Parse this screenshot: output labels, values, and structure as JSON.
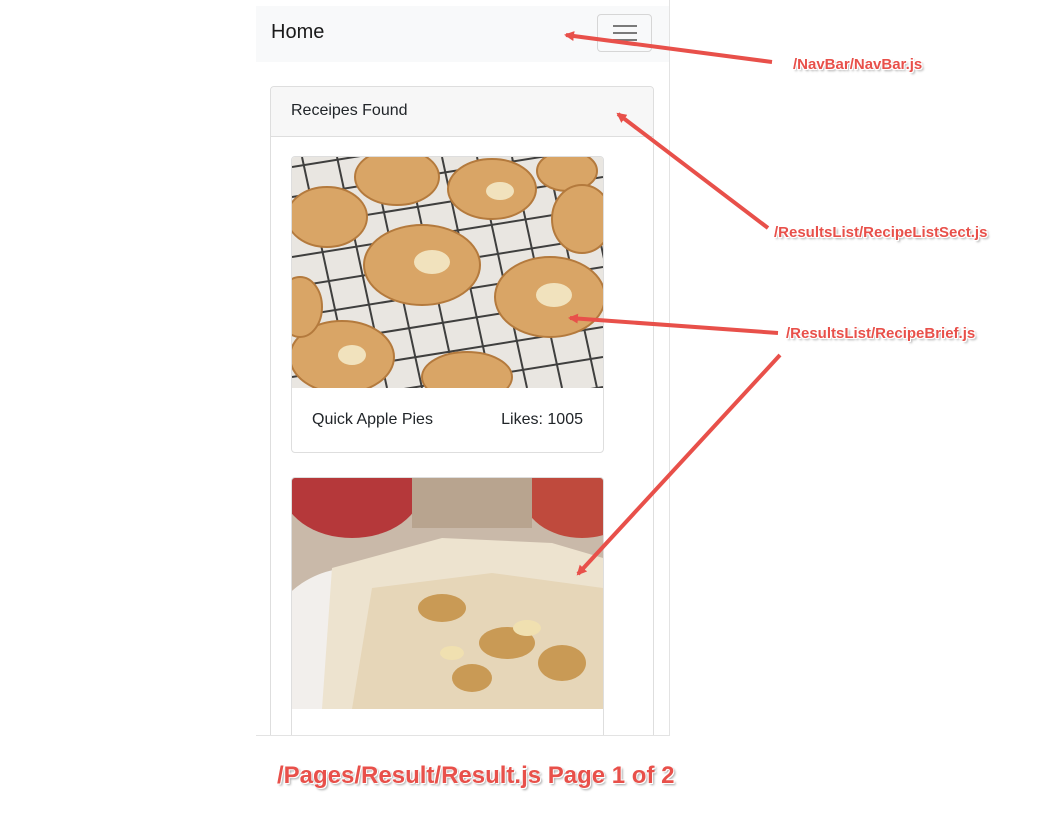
{
  "navbar": {
    "brand": "Home"
  },
  "results": {
    "header": "Receipes Found",
    "recipes": [
      {
        "title": "Quick Apple Pies",
        "likes": "Likes: 1005"
      },
      {
        "title": "",
        "likes": ""
      }
    ]
  },
  "annotations": {
    "navbar_file": "/NavBar/NavBar.js",
    "list_section_file": "/ResultsList/RecipeListSect.js",
    "recipe_brief_file": "/ResultsList/RecipeBrief.js",
    "page_caption": "/Pages/Result/Result.js Page 1 of 2"
  },
  "colors": {
    "annotation": "#e8504a",
    "navbar_bg": "#f8f9fa"
  }
}
